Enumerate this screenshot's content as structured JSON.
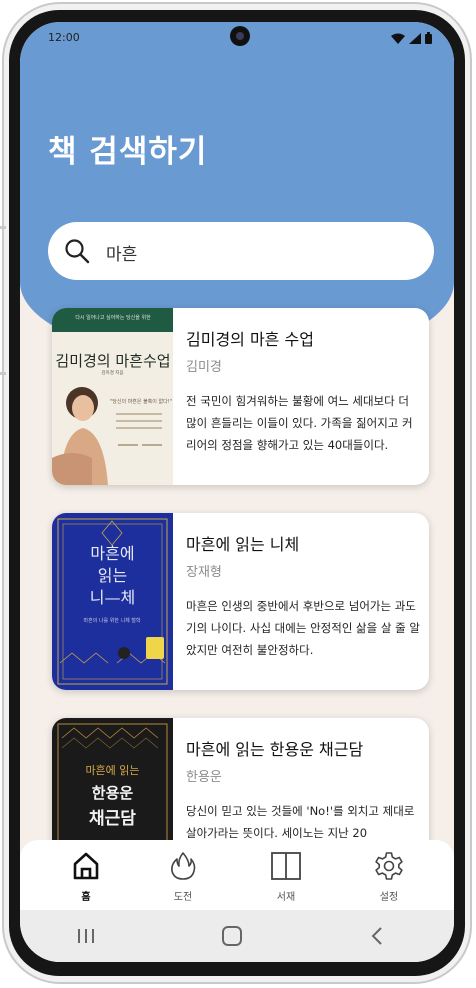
{
  "status_bar": {
    "time": "12:00"
  },
  "header": {
    "title": "책 검색하기"
  },
  "search": {
    "value": "마흔",
    "icon": "search-icon"
  },
  "books": [
    {
      "title": "김미경의 마흔 수업",
      "author": "김미경",
      "description": "전 국민이 힘겨워하는 불황에 여느 세대보다 더 많이 흔들리는 이들이 있다. 가족을 짊어지고 커리어의 정점을 향해가고 있는 40대들이다.",
      "cover": {
        "top_text": "다시 일어나고 싶어하는 당신을 위한",
        "title": "김미경의 마흔수업",
        "author": "김미경 지음",
        "quote": "\"당신의 마흔은 불혹이 없다!\""
      }
    },
    {
      "title": "마흔에 읽는 니체",
      "author": "장재형",
      "description": "마흔은 인생의 중반에서 후반으로 넘어가는 과도기의 나이다. 사십 대에는 안정적인 삶을 살 줄 알았지만 여전히 불안정하다.",
      "cover": {
        "title_lines": [
          "마흔에",
          "읽는",
          "니—체"
        ],
        "subtitle": "마흔의 나를 위한 니체 철학"
      }
    },
    {
      "title": "마흔에 읽는 한용운 채근담",
      "author": "한용운",
      "description": "당신이 믿고 있는 것들에 'No!'를 외치고 제대로 살아가라는 뜻이다. 세이노는 지난 20",
      "cover": {
        "title_lines": [
          "마흔에 읽는",
          "한용운",
          "채근담"
        ]
      }
    }
  ],
  "tabs": [
    {
      "label": "홈",
      "icon": "home-icon",
      "active": true
    },
    {
      "label": "도전",
      "icon": "flame-icon",
      "active": false
    },
    {
      "label": "서재",
      "icon": "book-icon",
      "active": false
    },
    {
      "label": "설정",
      "icon": "gear-icon",
      "active": false
    }
  ],
  "colors": {
    "header_blue": "#6a9ad2",
    "background": "#f6efe9",
    "card": "#ffffff",
    "nihtzsche_cover": "#1d2f9c",
    "chaegeundam_cover": "#1a1a1a"
  }
}
